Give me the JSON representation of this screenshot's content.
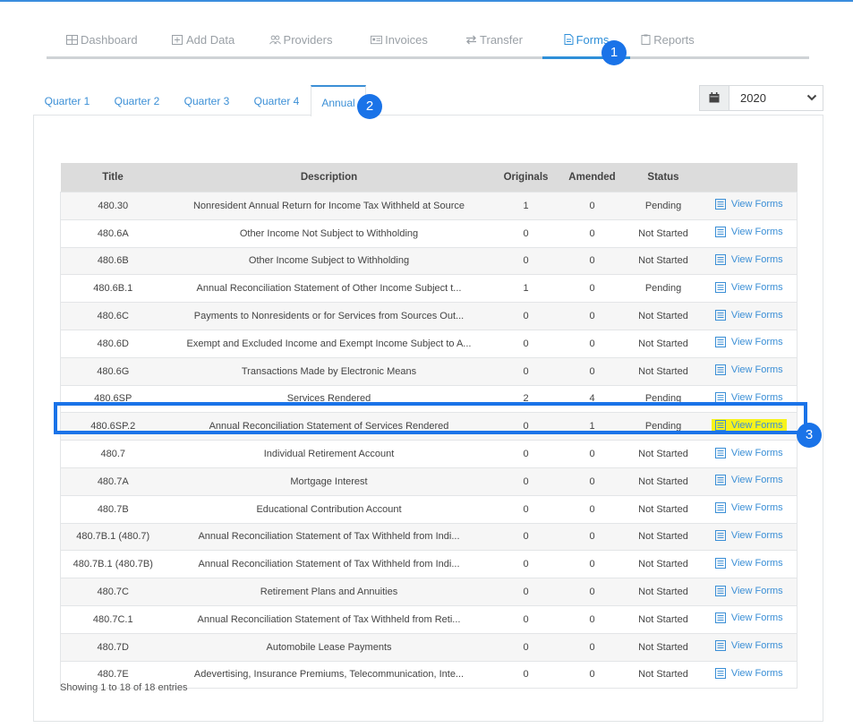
{
  "main_tabs": [
    {
      "label": "Dashboard",
      "icon": "table-icon"
    },
    {
      "label": "Add Data",
      "icon": "plus-square-icon"
    },
    {
      "label": "Providers",
      "icon": "users-icon"
    },
    {
      "label": "Invoices",
      "icon": "id-card-icon"
    },
    {
      "label": "Transfer",
      "icon": "exchange-icon"
    },
    {
      "label": "Forms",
      "icon": "file-icon",
      "active": true
    },
    {
      "label": "Reports",
      "icon": "clipboard-icon"
    }
  ],
  "quarter_tabs": [
    {
      "label": "Quarter 1"
    },
    {
      "label": "Quarter 2"
    },
    {
      "label": "Quarter 3"
    },
    {
      "label": "Quarter 4"
    },
    {
      "label": "Annual",
      "active": true
    }
  ],
  "year_select": {
    "value": "2020",
    "icon": "calendar-icon"
  },
  "badges": [
    "1",
    "2",
    "3"
  ],
  "table": {
    "headers": {
      "title": "Title",
      "description": "Description",
      "originals": "Originals",
      "amended": "Amended",
      "status": "Status"
    },
    "rows": [
      {
        "title": "480.30",
        "description": "Nonresident Annual Return for Income Tax Withheld at Source",
        "originals": "1",
        "amended": "0",
        "status": "Pending",
        "action": "View Forms"
      },
      {
        "title": "480.6A",
        "description": "Other Income Not Subject to Withholding",
        "originals": "0",
        "amended": "0",
        "status": "Not Started",
        "action": "View Forms"
      },
      {
        "title": "480.6B",
        "description": "Other Income Subject to Withholding",
        "originals": "0",
        "amended": "0",
        "status": "Not Started",
        "action": "View Forms"
      },
      {
        "title": "480.6B.1",
        "description": "Annual Reconciliation Statement of Other Income Subject t...",
        "originals": "1",
        "amended": "0",
        "status": "Pending",
        "action": "View Forms"
      },
      {
        "title": "480.6C",
        "description": "Payments to Nonresidents or for Services from Sources Out...",
        "originals": "0",
        "amended": "0",
        "status": "Not Started",
        "action": "View Forms"
      },
      {
        "title": "480.6D",
        "description": "Exempt and Excluded Income and Exempt Income Subject to A...",
        "originals": "0",
        "amended": "0",
        "status": "Not Started",
        "action": "View Forms"
      },
      {
        "title": "480.6G",
        "description": "Transactions Made by Electronic Means",
        "originals": "0",
        "amended": "0",
        "status": "Not Started",
        "action": "View Forms"
      },
      {
        "title": "480.6SP",
        "description": "Services Rendered",
        "originals": "2",
        "amended": "4",
        "status": "Pending",
        "action": "View Forms"
      },
      {
        "title": "480.6SP.2",
        "description": "Annual Reconciliation Statement of Services Rendered",
        "originals": "0",
        "amended": "1",
        "status": "Pending",
        "action": "View Forms",
        "highlighted": true
      },
      {
        "title": "480.7",
        "description": "Individual Retirement Account",
        "originals": "0",
        "amended": "0",
        "status": "Not Started",
        "action": "View Forms"
      },
      {
        "title": "480.7A",
        "description": "Mortgage Interest",
        "originals": "0",
        "amended": "0",
        "status": "Not Started",
        "action": "View Forms"
      },
      {
        "title": "480.7B",
        "description": "Educational Contribution Account",
        "originals": "0",
        "amended": "0",
        "status": "Not Started",
        "action": "View Forms"
      },
      {
        "title": "480.7B.1 (480.7)",
        "description": "Annual Reconciliation Statement of Tax Withheld from Indi...",
        "originals": "0",
        "amended": "0",
        "status": "Not Started",
        "action": "View Forms"
      },
      {
        "title": "480.7B.1 (480.7B)",
        "description": "Annual Reconciliation Statement of Tax Withheld from Indi...",
        "originals": "0",
        "amended": "0",
        "status": "Not Started",
        "action": "View Forms"
      },
      {
        "title": "480.7C",
        "description": "Retirement Plans and Annuities",
        "originals": "0",
        "amended": "0",
        "status": "Not Started",
        "action": "View Forms"
      },
      {
        "title": "480.7C.1",
        "description": "Annual Reconciliation Statement of Tax Withheld from Reti...",
        "originals": "0",
        "amended": "0",
        "status": "Not Started",
        "action": "View Forms"
      },
      {
        "title": "480.7D",
        "description": "Automobile Lease Payments",
        "originals": "0",
        "amended": "0",
        "status": "Not Started",
        "action": "View Forms"
      },
      {
        "title": "480.7E",
        "description": "Adevertising, Insurance Premiums, Telecommunication, Inte...",
        "originals": "0",
        "amended": "0",
        "status": "Not Started",
        "action": "View Forms"
      }
    ]
  },
  "footer": {
    "info": "Showing 1 to 18 of 18 entries"
  },
  "colors": {
    "accent": "#2f8fd8",
    "badge": "#1a73e8",
    "highlight": "#f7f31b"
  }
}
